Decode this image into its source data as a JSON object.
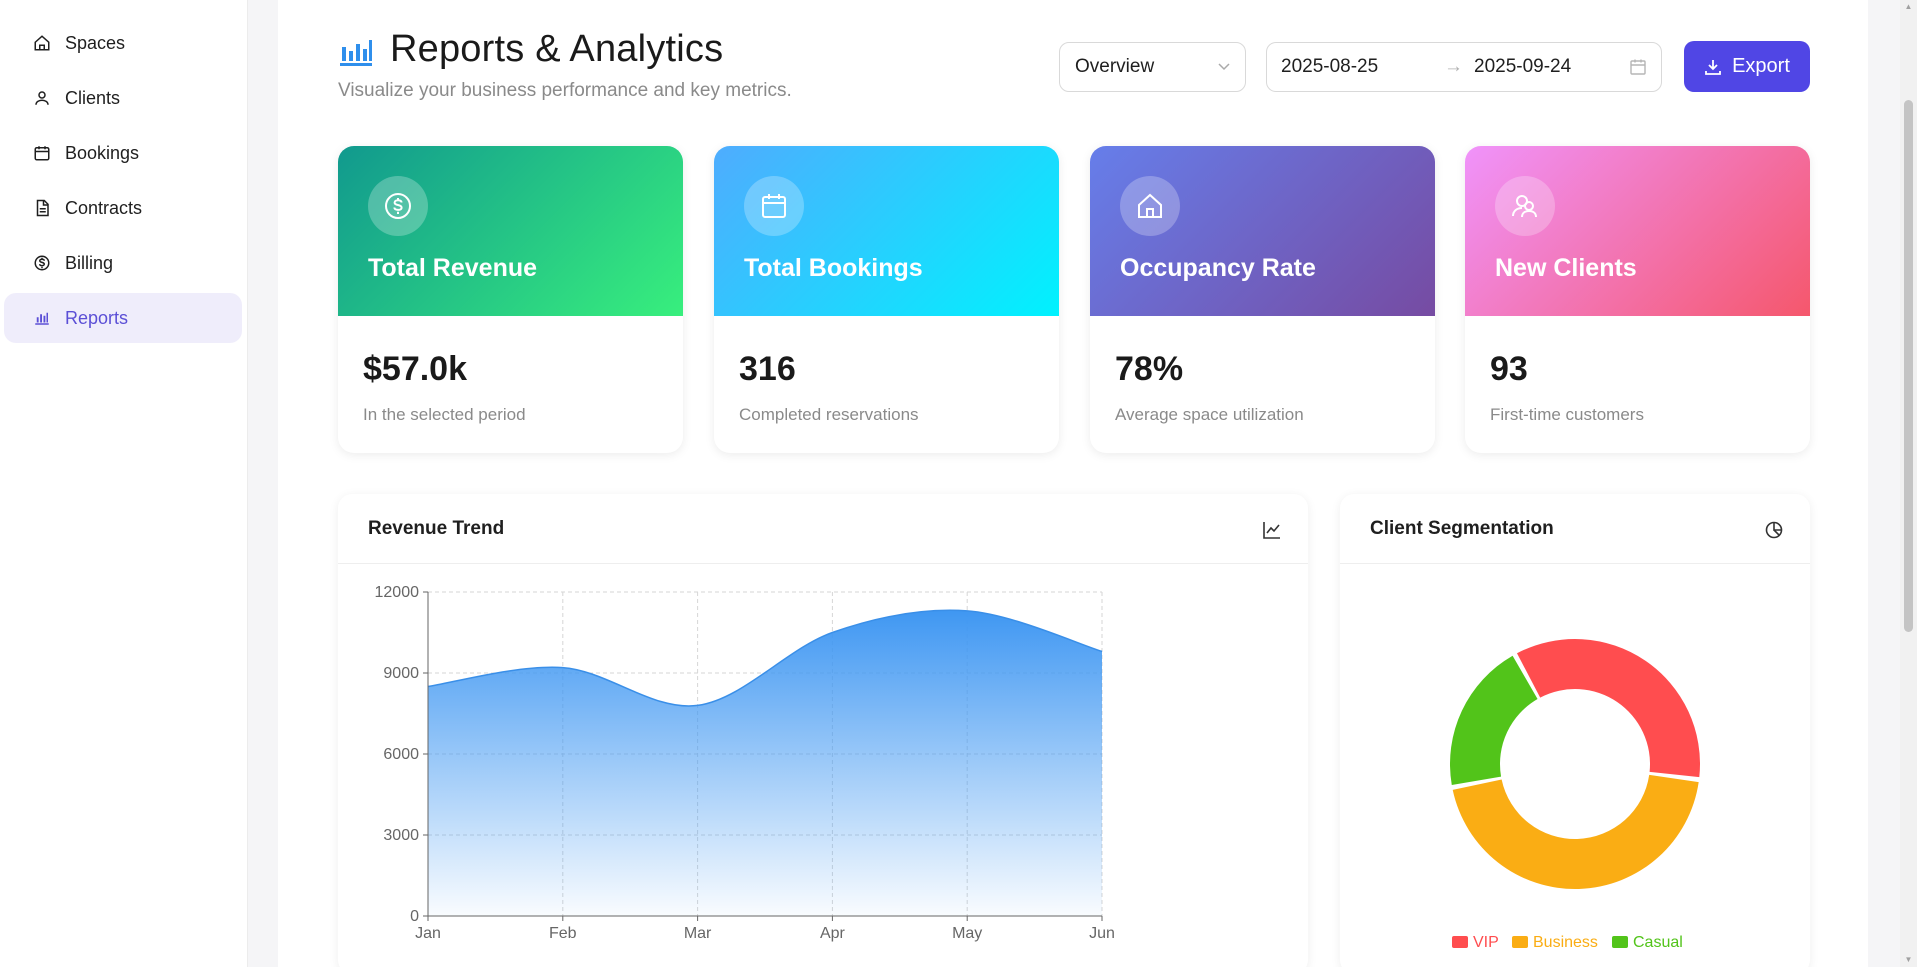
{
  "sidebar": {
    "items": [
      {
        "label": "Spaces",
        "icon": "home-icon"
      },
      {
        "label": "Clients",
        "icon": "user-icon"
      },
      {
        "label": "Bookings",
        "icon": "calendar-icon"
      },
      {
        "label": "Contracts",
        "icon": "document-icon"
      },
      {
        "label": "Billing",
        "icon": "dollar-icon"
      },
      {
        "label": "Reports",
        "icon": "bar-chart-icon",
        "active": true
      }
    ]
  },
  "header": {
    "title": "Reports & Analytics",
    "subtitle": "Visualize your business performance and key metrics.",
    "view_select": "Overview",
    "date_start": "2025-08-25",
    "date_arrow": "→",
    "date_end": "2025-09-24",
    "export_label": "Export"
  },
  "cards": [
    {
      "title": "Total Revenue",
      "value": "$57.0k",
      "desc": "In the selected period",
      "icon": "dollar-circle-icon",
      "gradient": [
        "#11998e",
        "#38ef7d"
      ]
    },
    {
      "title": "Total Bookings",
      "value": "316",
      "desc": "Completed reservations",
      "icon": "calendar-icon",
      "gradient": [
        "#4facfe",
        "#00f2fe"
      ]
    },
    {
      "title": "Occupancy Rate",
      "value": "78%",
      "desc": "Average space utilization",
      "icon": "home-icon",
      "gradient": [
        "#667eea",
        "#764ba2"
      ]
    },
    {
      "title": "New Clients",
      "value": "93",
      "desc": "First-time customers",
      "icon": "users-icon",
      "gradient": [
        "#f093fb",
        "#f5576c"
      ]
    }
  ],
  "revenue_panel": {
    "title": "Revenue Trend",
    "icon": "line-chart-icon"
  },
  "segment_panel": {
    "title": "Client Segmentation",
    "icon": "pie-chart-icon"
  },
  "colors": {
    "accent": "#5046e5",
    "area": "#4a9ff5",
    "vip": "#ff4d4f",
    "business": "#faad14",
    "casual": "#52c41a"
  },
  "chart_data": [
    {
      "type": "area",
      "categories": [
        "Jan",
        "Feb",
        "Mar",
        "Apr",
        "May",
        "Jun"
      ],
      "series": [
        {
          "values": [
            8500,
            9200,
            7800,
            10500,
            11300,
            9800
          ]
        }
      ],
      "ylim": [
        0,
        12000
      ],
      "yticks": [
        "0",
        "3000",
        "6000",
        "9000",
        "12000"
      ],
      "grid": true
    },
    {
      "type": "pie",
      "labels": [
        "VIP",
        "Business",
        "Casual"
      ],
      "values": [
        35,
        45,
        20
      ],
      "colors": [
        "#ff4d4f",
        "#faad14",
        "#52c41a"
      ],
      "legend": "bottom"
    }
  ]
}
